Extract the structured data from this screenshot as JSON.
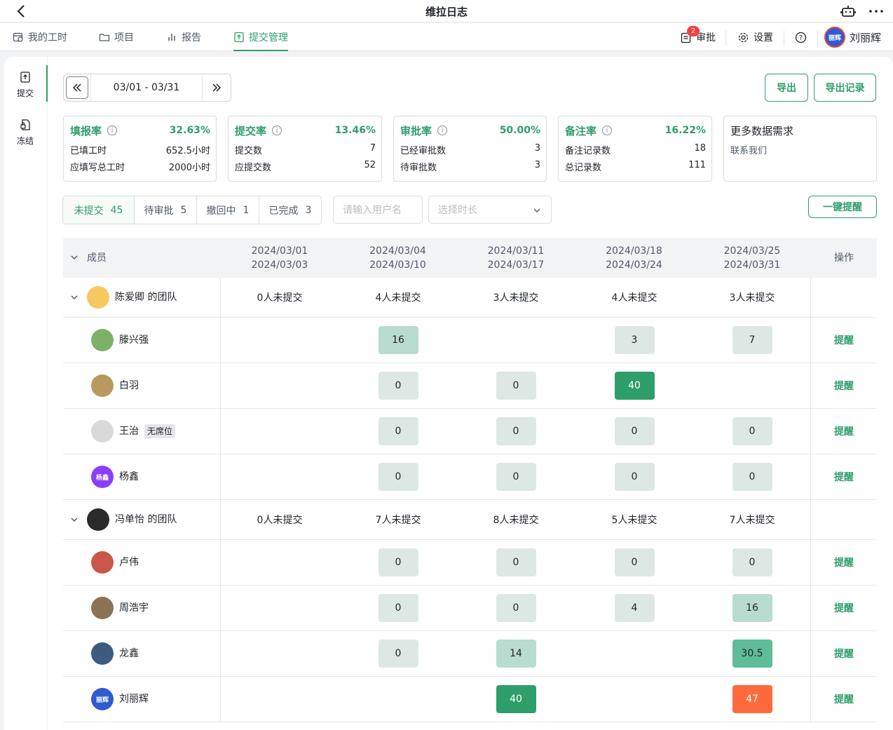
{
  "app": {
    "title": "维拉日志"
  },
  "nav": {
    "tabs": [
      {
        "label": "我的工时",
        "icon": "calendar-clock-icon"
      },
      {
        "label": "项目",
        "icon": "folder-icon"
      },
      {
        "label": "报告",
        "icon": "bar-chart-icon"
      },
      {
        "label": "提交管理",
        "icon": "upload-doc-icon",
        "active": true
      }
    ],
    "approval_label": "审批",
    "approval_badge": "2",
    "settings_label": "设置",
    "user_name": "刘丽辉",
    "user_avatar_text": "丽辉"
  },
  "sidebar": {
    "items": [
      {
        "label": "提交",
        "icon": "submit-icon",
        "active": true
      },
      {
        "label": "冻结",
        "icon": "freeze-icon"
      }
    ]
  },
  "date_range": {
    "label": "03/01 - 03/31"
  },
  "actions": {
    "export_label": "导出",
    "export_log_label": "导出记录",
    "remind_all_label": "一键提醒"
  },
  "stats": [
    {
      "name": "填报率",
      "pct": "32.63%",
      "rows": [
        [
          "已填工时",
          "652.5小时"
        ],
        [
          "应填写总工时",
          "2000小时"
        ]
      ]
    },
    {
      "name": "提交率",
      "pct": "13.46%",
      "rows": [
        [
          "提交数",
          "7"
        ],
        [
          "应提交数",
          "52"
        ]
      ]
    },
    {
      "name": "审批率",
      "pct": "50.00%",
      "rows": [
        [
          "已经审批数",
          "3"
        ],
        [
          "待审批数",
          "3"
        ]
      ]
    },
    {
      "name": "备注率",
      "pct": "16.22%",
      "rows": [
        [
          "备注记录数",
          "18"
        ],
        [
          "总记录数",
          "111"
        ]
      ]
    }
  ],
  "more_data": {
    "title": "更多数据需求",
    "sub": "联系我们"
  },
  "filters": {
    "tabs": [
      {
        "label": "未提交",
        "count": "45"
      },
      {
        "label": "待审批",
        "count": "5"
      },
      {
        "label": "撤回中",
        "count": "1"
      },
      {
        "label": "已完成",
        "count": "3"
      }
    ],
    "username_placeholder": "请输入用户名",
    "duration_placeholder": "选择时长"
  },
  "table": {
    "member_header": "成员",
    "action_header": "操作",
    "weeks": [
      [
        "2024/03/01",
        "2024/03/03"
      ],
      [
        "2024/03/04",
        "2024/03/10"
      ],
      [
        "2024/03/11",
        "2024/03/17"
      ],
      [
        "2024/03/18",
        "2024/03/24"
      ],
      [
        "2024/03/25",
        "2024/03/31"
      ]
    ],
    "remind_label": "提醒",
    "rows": [
      {
        "type": "team",
        "name": "陈爱卿 的团队",
        "avatar": "#f6c860",
        "cells": [
          "0人未提交",
          "4人未提交",
          "3人未提交",
          "4人未提交",
          "3人未提交"
        ]
      },
      {
        "type": "member",
        "name": "滕兴强",
        "avatar": "#7fb069",
        "cells": [
          null,
          {
            "v": "16",
            "lvl": 1
          },
          null,
          {
            "v": "3",
            "lvl": 0
          },
          {
            "v": "7",
            "lvl": 0
          }
        ]
      },
      {
        "type": "member",
        "name": "白羽",
        "avatar": "#b89a5e",
        "cells": [
          null,
          {
            "v": "0",
            "lvl": 0
          },
          {
            "v": "0",
            "lvl": 0
          },
          {
            "v": "40",
            "lvl": 3
          },
          null
        ]
      },
      {
        "type": "member",
        "name": "王治",
        "avatar": "#d9d9d9",
        "tag": "无席位",
        "cells": [
          null,
          {
            "v": "0",
            "lvl": 0
          },
          {
            "v": "0",
            "lvl": 0
          },
          {
            "v": "0",
            "lvl": 0
          },
          {
            "v": "0",
            "lvl": 0
          }
        ]
      },
      {
        "type": "member",
        "name": "杨鑫",
        "avatar": "#8a3ffc",
        "avatar_text": "杨鑫",
        "cells": [
          null,
          {
            "v": "0",
            "lvl": 0
          },
          {
            "v": "0",
            "lvl": 0
          },
          {
            "v": "0",
            "lvl": 0
          },
          {
            "v": "0",
            "lvl": 0
          }
        ]
      },
      {
        "type": "team",
        "name": "冯单怡 的团队",
        "avatar": "#2b2b2b",
        "cells": [
          "0人未提交",
          "7人未提交",
          "8人未提交",
          "5人未提交",
          "7人未提交"
        ]
      },
      {
        "type": "member",
        "name": "卢伟",
        "avatar": "#c9584a",
        "cells": [
          null,
          {
            "v": "0",
            "lvl": 0
          },
          {
            "v": "0",
            "lvl": 0
          },
          {
            "v": "0",
            "lvl": 0
          },
          {
            "v": "0",
            "lvl": 0
          }
        ]
      },
      {
        "type": "member",
        "name": "周浩宇",
        "avatar": "#8c7355",
        "cells": [
          null,
          {
            "v": "0",
            "lvl": 0
          },
          {
            "v": "0",
            "lvl": 0
          },
          {
            "v": "4",
            "lvl": 0
          },
          {
            "v": "16",
            "lvl": 1
          }
        ]
      },
      {
        "type": "member",
        "name": "龙鑫",
        "avatar": "#3d5a80",
        "cells": [
          null,
          {
            "v": "0",
            "lvl": 0
          },
          {
            "v": "14",
            "lvl": 1
          },
          null,
          {
            "v": "30.5",
            "lvl": 2
          }
        ]
      },
      {
        "type": "member",
        "name": "刘丽辉",
        "avatar": "#2f5bd3",
        "avatar_text": "丽辉",
        "cells": [
          null,
          null,
          {
            "v": "40",
            "lvl": 3
          },
          null,
          {
            "v": "47",
            "lvl": 4
          }
        ]
      }
    ]
  }
}
